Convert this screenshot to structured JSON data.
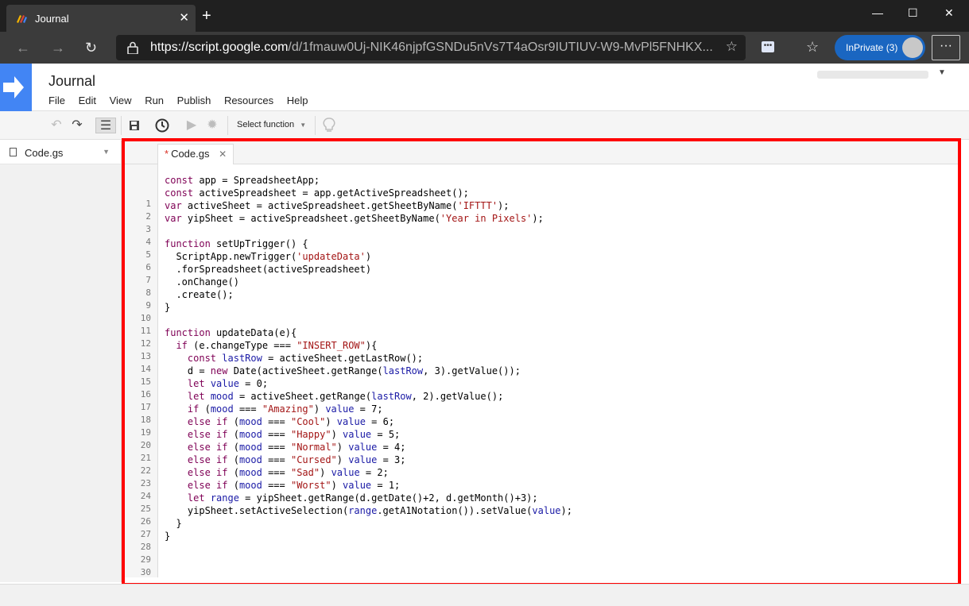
{
  "browser": {
    "tab_title": "Journal",
    "url_host": "https://script.google.com",
    "url_path": "/d/1fmauw0Uj-NIK46njpfGSNDu5nVs7T4aOsr9IUTIUV-W9-MvPl5FNHKX...",
    "inprivate_label": "InPrivate (3)"
  },
  "app": {
    "project_title": "Journal",
    "menu": [
      "File",
      "Edit",
      "View",
      "Run",
      "Publish",
      "Resources",
      "Help"
    ],
    "select_function_label": "Select function"
  },
  "files": [
    {
      "name": "Code.gs"
    }
  ],
  "editor": {
    "tab_label": "Code.gs",
    "modified_marker": "*",
    "line_count": 30,
    "lines": [
      "const app = SpreadsheetApp;",
      "const activeSpreadsheet = app.getActiveSpreadsheet();",
      "var activeSheet = activeSpreadsheet.getSheetByName('IFTTT');",
      "var yipSheet = activeSpreadsheet.getSheetByName('Year in Pixels');",
      "",
      "function setUpTrigger() {",
      "  ScriptApp.newTrigger('updateData')",
      "  .forSpreadsheet(activeSpreadsheet)",
      "  .onChange()",
      "  .create();",
      "}",
      "",
      "function updateData(e){",
      "  if (e.changeType === \"INSERT_ROW\"){",
      "    const lastRow = activeSheet.getLastRow();",
      "    d = new Date(activeSheet.getRange(lastRow, 3).getValue());",
      "    let value = 0;",
      "    let mood = activeSheet.getRange(lastRow, 2).getValue();",
      "    if (mood === \"Amazing\") value = 7;",
      "    else if (mood === \"Cool\") value = 6;",
      "    else if (mood === \"Happy\") value = 5;",
      "    else if (mood === \"Normal\") value = 4;",
      "    else if (mood === \"Cursed\") value = 3;",
      "    else if (mood === \"Sad\") value = 2;",
      "    else if (mood === \"Worst\") value = 1;",
      "    let range = yipSheet.getRange(d.getDate()+2, d.getMonth()+3);",
      "    yipSheet.setActiveSelection(range.getA1Notation()).setValue(value);",
      "  }",
      "}",
      ""
    ]
  },
  "colors": {
    "highlight_border": "#ff0000",
    "inprivate_badge": "#1a66c1",
    "apps_script_blue": "#4285f4"
  }
}
